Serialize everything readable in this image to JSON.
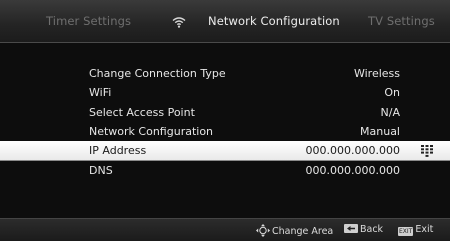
{
  "tabs": {
    "left": "Timer Settings",
    "active": "Network Configuration",
    "right": "TV Settings"
  },
  "settings": [
    {
      "label": "Change Connection Type",
      "value": "Wireless"
    },
    {
      "label": "WiFi",
      "value": "On"
    },
    {
      "label": "Select Access Point",
      "value": "N/A"
    },
    {
      "label": "Network Configuration",
      "value": "Manual"
    },
    {
      "label": "IP Address",
      "value": "000.000.000.000"
    },
    {
      "label": "DNS",
      "value": "000.000.000.000"
    }
  ],
  "selected_row": "IP Address",
  "help": {
    "change_area": "Change Area",
    "back": "Back",
    "exit_key": "EXIT",
    "exit": "Exit"
  },
  "icons": {
    "tab_icon": "wifi-icon",
    "ip_row_icon": "keyboard-grid-icon",
    "change_area_icon": "four-way-arrows-icon",
    "back_key_icon": "back-arrow-key-icon"
  }
}
